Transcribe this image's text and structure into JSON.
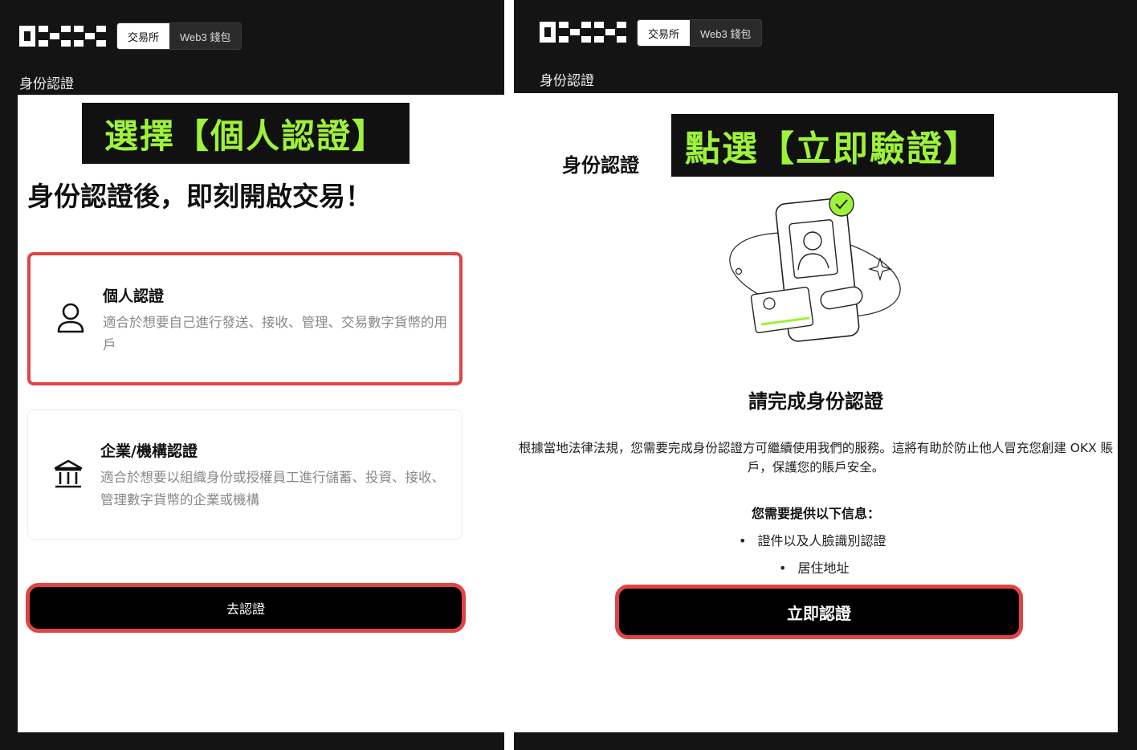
{
  "left": {
    "header": {
      "logo": "OKX",
      "toggle": [
        "交易所",
        "Web3 錢包"
      ],
      "page_label": "身份認證"
    },
    "banner": "選擇【個人認證】",
    "headline": "身份認證後，即刻開啟交易！",
    "options": [
      {
        "icon": "person-icon",
        "title": "個人認證",
        "desc": "適合於想要自己進行發送、接收、管理、交易數字貨幣的用戶"
      },
      {
        "icon": "institution-icon",
        "title": "企業/機構認證",
        "desc": "適合於想要以組織身份或授權員工進行儲蓄、投資、接收、管理數字貨幣的企業或機構"
      }
    ],
    "button": "去認證"
  },
  "right": {
    "header": {
      "logo": "OKX",
      "toggle": [
        "交易所",
        "Web3 錢包"
      ],
      "page_label": "身份認證"
    },
    "small_title": "身份認證",
    "banner": "點選【立即驗證】",
    "complete_title": "請完成身份認證",
    "notice": "根據當地法律法規，您需要完成身份認證方可繼續使用我們的服務。這將有助於防止他人冒充您創建 OKX 賬戶，保護您的賬戶安全。",
    "requirements_title": "您需要提供以下信息：",
    "requirements": [
      "證件以及人臉識別認證",
      "居住地址"
    ],
    "button": "立即認證"
  },
  "colors": {
    "banner_text": "#9ef23a",
    "highlight": "#e04444",
    "background_dark": "#141414",
    "illustration_accent": "#9ef23a"
  }
}
